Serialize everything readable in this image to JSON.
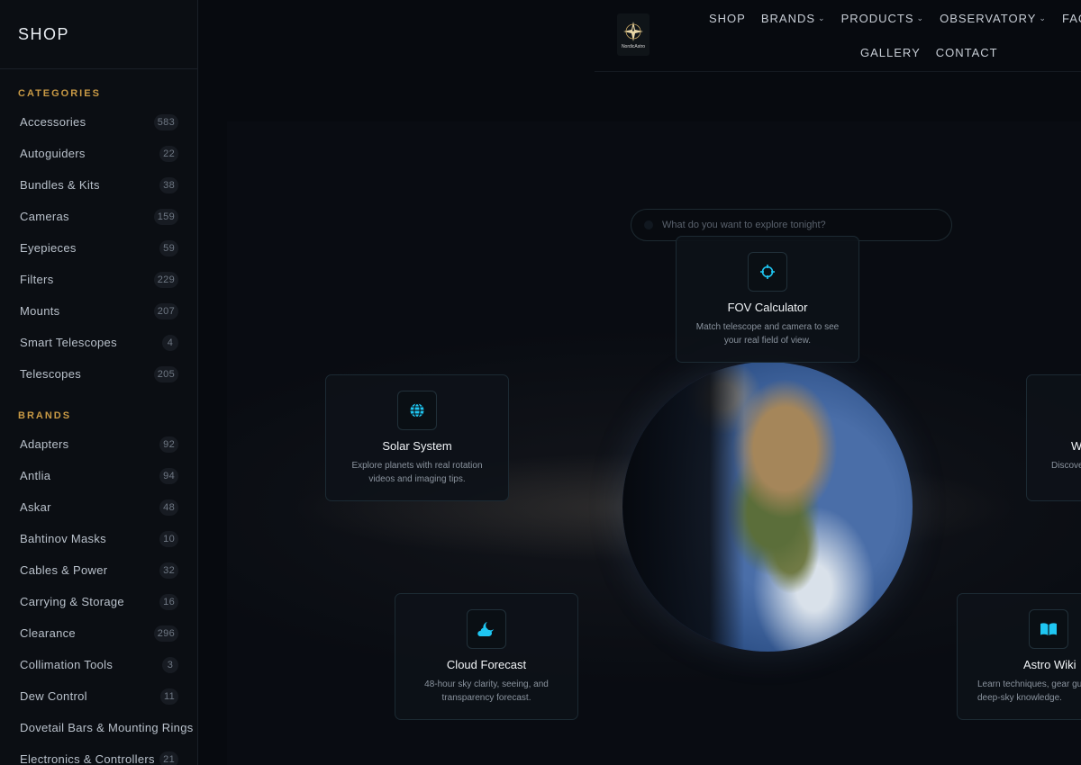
{
  "sidebar": {
    "title": "SHOP",
    "categories_heading": "CATEGORIES",
    "categories": [
      {
        "label": "Accessories",
        "count": "583"
      },
      {
        "label": "Autoguiders",
        "count": "22"
      },
      {
        "label": "Bundles & Kits",
        "count": "38"
      },
      {
        "label": "Cameras",
        "count": "159"
      },
      {
        "label": "Eyepieces",
        "count": "59"
      },
      {
        "label": "Filters",
        "count": "229"
      },
      {
        "label": "Mounts",
        "count": "207"
      },
      {
        "label": "Smart Telescopes",
        "count": "4"
      },
      {
        "label": "Telescopes",
        "count": "205"
      }
    ],
    "brands_heading": "BRANDS",
    "brands": [
      {
        "label": "Adapters",
        "count": "92"
      },
      {
        "label": "Antlia",
        "count": "94"
      },
      {
        "label": "Askar",
        "count": "48"
      },
      {
        "label": "Bahtinov Masks",
        "count": "10"
      },
      {
        "label": "Cables & Power",
        "count": "32"
      },
      {
        "label": "Carrying & Storage",
        "count": "16"
      },
      {
        "label": "Clearance",
        "count": "296"
      },
      {
        "label": "Collimation Tools",
        "count": "3"
      },
      {
        "label": "Dew Control",
        "count": "11"
      },
      {
        "label": "Dovetail Bars & Mounting Rings",
        "count": ""
      },
      {
        "label": "Electronics & Controllers",
        "count": "21"
      }
    ]
  },
  "header": {
    "logo_text": "NordicAstro",
    "nav_row1": [
      {
        "label": "SHOP",
        "dropdown": false
      },
      {
        "label": "BRANDS",
        "dropdown": true
      },
      {
        "label": "PRODUCTS",
        "dropdown": true
      },
      {
        "label": "OBSERVATORY",
        "dropdown": true
      },
      {
        "label": "FAQ",
        "dropdown": false
      }
    ],
    "nav_row2": [
      {
        "label": "GALLERY"
      },
      {
        "label": "CONTACT"
      }
    ]
  },
  "search": {
    "placeholder": "What do you want to explore tonight?"
  },
  "cards": {
    "fov": {
      "title": "FOV Calculator",
      "desc": "Match telescope and camera to see your real field of view.",
      "icon": "crosshair-icon"
    },
    "solar": {
      "title": "Solar System",
      "desc": "Explore planets with real rotation videos and imaging tips.",
      "icon": "globe-icon"
    },
    "cloud": {
      "title": "Cloud Forecast",
      "desc": "48-hour sky clarity, seeing, and transparency forecast.",
      "icon": "cloud-moon-icon"
    },
    "wiki": {
      "title": "Astro Wiki",
      "desc": "Learn techniques, gear guides and deep-sky knowledge.",
      "icon": "book-icon"
    },
    "right": {
      "title": "W",
      "desc": "Discove yo",
      "icon": "sky-icon"
    }
  },
  "colors": {
    "accent": "#1fc6f2",
    "section_heading": "#c99a45"
  }
}
